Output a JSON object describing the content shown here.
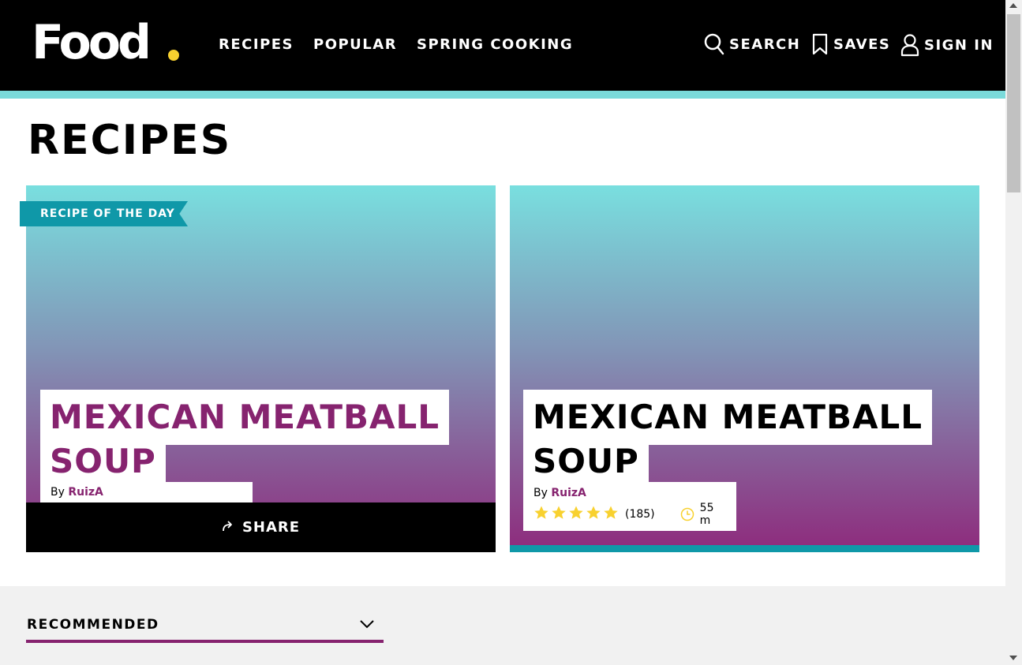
{
  "header": {
    "logo_text": "Food",
    "nav": [
      "RECIPES",
      "POPULAR",
      "SPRING COOKING"
    ],
    "search_label": "SEARCH",
    "saves_label": "SAVES",
    "signin_label": "SIGN IN"
  },
  "page_title": "RECIPES",
  "cards": [
    {
      "ribbon": "RECIPE OF THE DAY",
      "title_line1": "MEXICAN MEATBALL",
      "title_line2": "SOUP",
      "by_prefix": "By",
      "author": "RuizA",
      "share_label": "SHARE"
    },
    {
      "title_line1": "MEXICAN MEATBALL",
      "title_line2": "SOUP",
      "by_prefix": "By",
      "author": "RuizA",
      "rating_stars": 5,
      "rating_count": "(185)",
      "time": "55 m"
    }
  ],
  "recommended": {
    "label": "RECOMMENDED"
  },
  "colors": {
    "accent_purple": "#86236f",
    "teal": "#0f98a8",
    "light_teal": "#7adada",
    "star_yellow": "#f8d12f"
  }
}
